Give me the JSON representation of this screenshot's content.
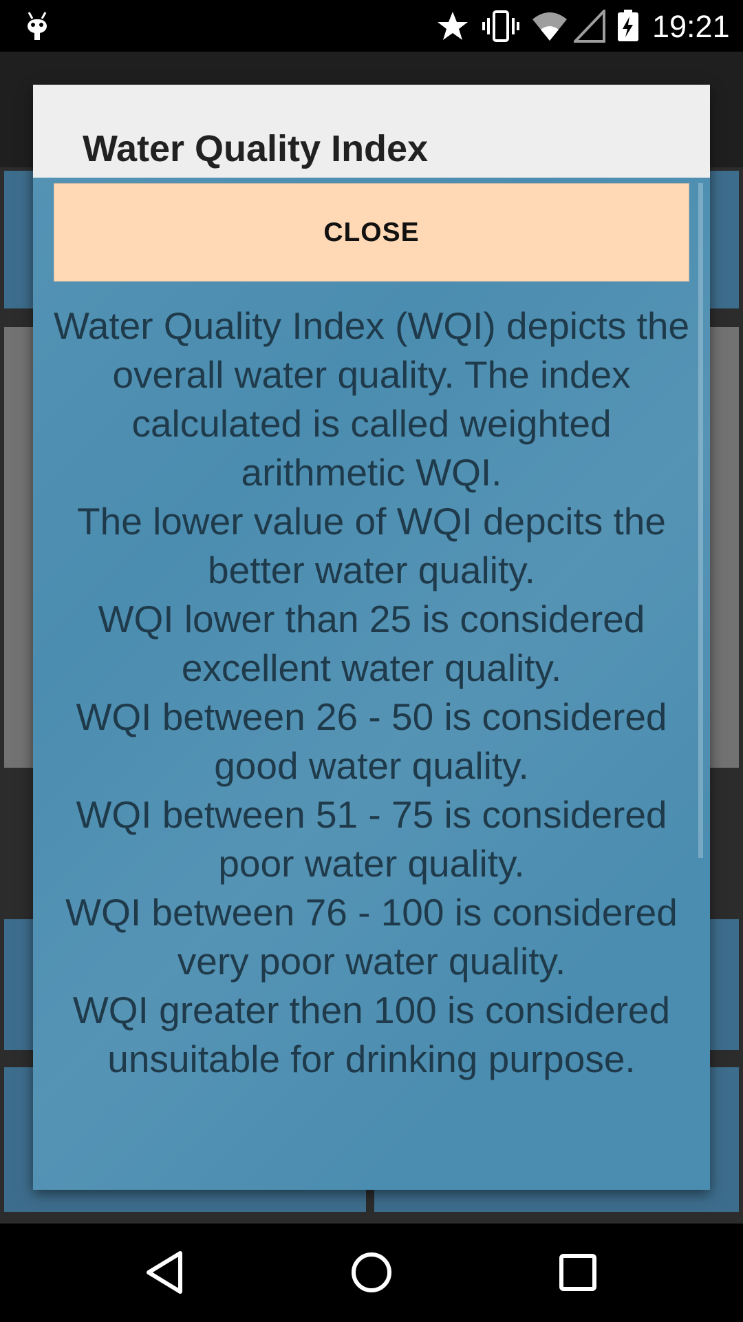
{
  "status_bar": {
    "time": "19:21",
    "icons": [
      "android-debug-icon",
      "star-icon",
      "vibrate-icon",
      "wifi-icon",
      "signal-icon",
      "battery-charging-icon"
    ]
  },
  "dialog": {
    "title": "Water Quality Index",
    "close_label": "CLOSE",
    "message_lines": [
      "Water Quality Index (WQI) depicts the overall water quality. The index calculated is called weighted arithmetic WQI.",
      "The lower value of WQI depcits the better water quality.",
      "WQI lower than 25 is considered excellent water quality.",
      "WQI between 26 - 50 is considered good water quality.",
      "WQI between 51 - 75 is considered poor water quality.",
      "WQI between 76 - 100 is considered very poor water quality.",
      "WQI greater then 100 is considered unsuitable for drinking purpose."
    ]
  },
  "nav_bar": {
    "buttons": [
      "back",
      "home",
      "recents"
    ]
  }
}
